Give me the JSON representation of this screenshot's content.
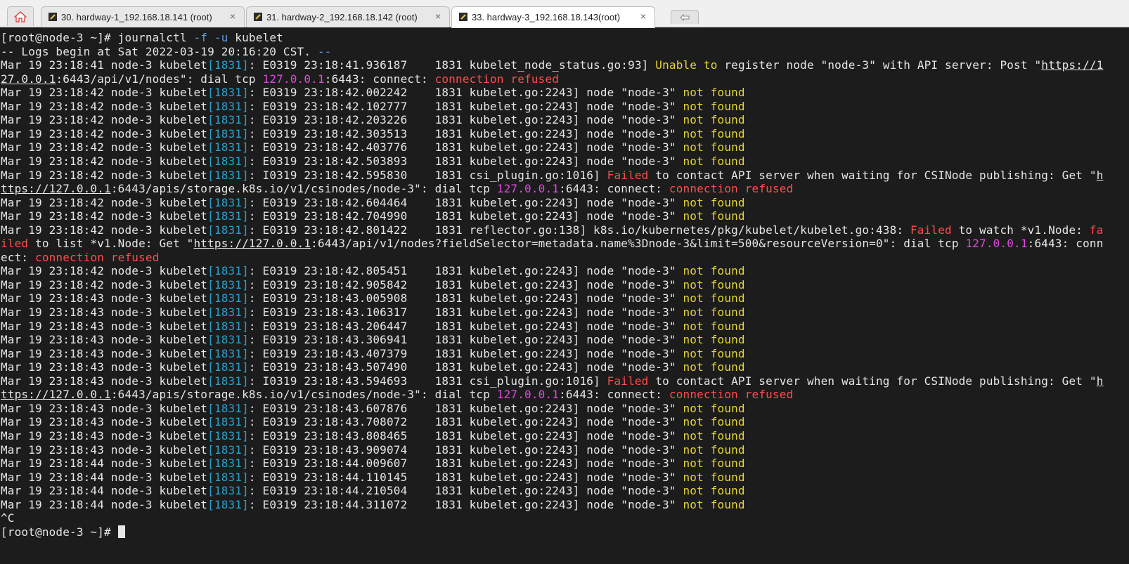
{
  "tabs": [
    {
      "label": "30. hardway-1_192.168.18.141 (root)",
      "close": "×",
      "icon": "terminal-tab-icon"
    },
    {
      "label": "31. hardway-2_192.168.18.142 (root)",
      "close": "×",
      "icon": "terminal-tab-icon"
    },
    {
      "label": "33. hardway-3_192.168.18.143(root)",
      "close": "×",
      "icon": "terminal-tab-icon"
    }
  ],
  "active_tab": 2,
  "colors": {
    "background": "#1c1c1c",
    "text": "#e6e6e6",
    "pid": "#2aa1c9",
    "warning": "#e5d635",
    "error": "#ff4d4d",
    "ip": "#e049e0"
  },
  "lines": [
    [
      {
        "t": "[root@node-3 ~]# journalctl "
      },
      {
        "t": "-f -u",
        "c": "opt"
      },
      {
        "t": " kubelet"
      }
    ],
    [
      {
        "t": "-- Logs begin at Sat 2022-03-19 20:16:20 CST. "
      },
      {
        "t": "--",
        "c": "opt"
      }
    ],
    [
      {
        "t": "Mar 19 23:18:41 node-3 kubelet"
      },
      {
        "t": "[1831]",
        "c": "pid"
      },
      {
        "t": ": E0319 23:18:41.936187    1831 kubelet_node_status.go:93] "
      },
      {
        "t": "Unable to",
        "c": "warn"
      },
      {
        "t": " register node \"node-3\" with API server: Post \""
      },
      {
        "t": "https://1",
        "c": "url"
      }
    ],
    [
      {
        "t": "27.0.0.1",
        "c": "url"
      },
      {
        "t": ":6443/api/v1/nodes\": dial tcp "
      },
      {
        "t": "127.0.0.1",
        "c": "ip"
      },
      {
        "t": ":6443: connect: "
      },
      {
        "t": "connection refused",
        "c": "err"
      }
    ],
    [
      {
        "t": "Mar 19 23:18:42 node-3 kubelet"
      },
      {
        "t": "[1831]",
        "c": "pid"
      },
      {
        "t": ": E0319 23:18:42.002242    1831 kubelet.go:2243] node \"node-3\" "
      },
      {
        "t": "not found",
        "c": "warn"
      }
    ],
    [
      {
        "t": "Mar 19 23:18:42 node-3 kubelet"
      },
      {
        "t": "[1831]",
        "c": "pid"
      },
      {
        "t": ": E0319 23:18:42.102777    1831 kubelet.go:2243] node \"node-3\" "
      },
      {
        "t": "not found",
        "c": "warn"
      }
    ],
    [
      {
        "t": "Mar 19 23:18:42 node-3 kubelet"
      },
      {
        "t": "[1831]",
        "c": "pid"
      },
      {
        "t": ": E0319 23:18:42.203226    1831 kubelet.go:2243] node \"node-3\" "
      },
      {
        "t": "not found",
        "c": "warn"
      }
    ],
    [
      {
        "t": "Mar 19 23:18:42 node-3 kubelet"
      },
      {
        "t": "[1831]",
        "c": "pid"
      },
      {
        "t": ": E0319 23:18:42.303513    1831 kubelet.go:2243] node \"node-3\" "
      },
      {
        "t": "not found",
        "c": "warn"
      }
    ],
    [
      {
        "t": "Mar 19 23:18:42 node-3 kubelet"
      },
      {
        "t": "[1831]",
        "c": "pid"
      },
      {
        "t": ": E0319 23:18:42.403776    1831 kubelet.go:2243] node \"node-3\" "
      },
      {
        "t": "not found",
        "c": "warn"
      }
    ],
    [
      {
        "t": "Mar 19 23:18:42 node-3 kubelet"
      },
      {
        "t": "[1831]",
        "c": "pid"
      },
      {
        "t": ": E0319 23:18:42.503893    1831 kubelet.go:2243] node \"node-3\" "
      },
      {
        "t": "not found",
        "c": "warn"
      }
    ],
    [
      {
        "t": "Mar 19 23:18:42 node-3 kubelet"
      },
      {
        "t": "[1831]",
        "c": "pid"
      },
      {
        "t": ": I0319 23:18:42.595830    1831 csi_plugin.go:1016] "
      },
      {
        "t": "Failed",
        "c": "err"
      },
      {
        "t": " to contact API server when waiting for CSINode publishing: Get \""
      },
      {
        "t": "h",
        "c": "url"
      }
    ],
    [
      {
        "t": "ttps://127.0.0.1",
        "c": "url"
      },
      {
        "t": ":6443/apis/storage.k8s.io/v1/csinodes/node-3\": dial tcp "
      },
      {
        "t": "127.0.0.1",
        "c": "ip"
      },
      {
        "t": ":6443: connect: "
      },
      {
        "t": "connection refused",
        "c": "err"
      }
    ],
    [
      {
        "t": "Mar 19 23:18:42 node-3 kubelet"
      },
      {
        "t": "[1831]",
        "c": "pid"
      },
      {
        "t": ": E0319 23:18:42.604464    1831 kubelet.go:2243] node \"node-3\" "
      },
      {
        "t": "not found",
        "c": "warn"
      }
    ],
    [
      {
        "t": "Mar 19 23:18:42 node-3 kubelet"
      },
      {
        "t": "[1831]",
        "c": "pid"
      },
      {
        "t": ": E0319 23:18:42.704990    1831 kubelet.go:2243] node \"node-3\" "
      },
      {
        "t": "not found",
        "c": "warn"
      }
    ],
    [
      {
        "t": "Mar 19 23:18:42 node-3 kubelet"
      },
      {
        "t": "[1831]",
        "c": "pid"
      },
      {
        "t": ": E0319 23:18:42.801422    1831 reflector.go:138] k8s.io/kubernetes/pkg/kubelet/kubelet.go:438: "
      },
      {
        "t": "Failed",
        "c": "err"
      },
      {
        "t": " to watch *v1.Node: "
      },
      {
        "t": "fa",
        "c": "err"
      }
    ],
    [
      {
        "t": "iled",
        "c": "err"
      },
      {
        "t": " to list *v1.Node: Get \""
      },
      {
        "t": "https://127.0.0.1",
        "c": "url"
      },
      {
        "t": ":6443/api/v1/nodes?fieldSelector=metadata.name%3Dnode-3&limit=500&resourceVersion=0\": dial tcp "
      },
      {
        "t": "127.0.0.1",
        "c": "ip"
      },
      {
        "t": ":6443: conn"
      }
    ],
    [
      {
        "t": "ect: "
      },
      {
        "t": "connection refused",
        "c": "err"
      }
    ],
    [
      {
        "t": "Mar 19 23:18:42 node-3 kubelet"
      },
      {
        "t": "[1831]",
        "c": "pid"
      },
      {
        "t": ": E0319 23:18:42.805451    1831 kubelet.go:2243] node \"node-3\" "
      },
      {
        "t": "not found",
        "c": "warn"
      }
    ],
    [
      {
        "t": "Mar 19 23:18:42 node-3 kubelet"
      },
      {
        "t": "[1831]",
        "c": "pid"
      },
      {
        "t": ": E0319 23:18:42.905842    1831 kubelet.go:2243] node \"node-3\" "
      },
      {
        "t": "not found",
        "c": "warn"
      }
    ],
    [
      {
        "t": "Mar 19 23:18:43 node-3 kubelet"
      },
      {
        "t": "[1831]",
        "c": "pid"
      },
      {
        "t": ": E0319 23:18:43.005908    1831 kubelet.go:2243] node \"node-3\" "
      },
      {
        "t": "not found",
        "c": "warn"
      }
    ],
    [
      {
        "t": "Mar 19 23:18:43 node-3 kubelet"
      },
      {
        "t": "[1831]",
        "c": "pid"
      },
      {
        "t": ": E0319 23:18:43.106317    1831 kubelet.go:2243] node \"node-3\" "
      },
      {
        "t": "not found",
        "c": "warn"
      }
    ],
    [
      {
        "t": "Mar 19 23:18:43 node-3 kubelet"
      },
      {
        "t": "[1831]",
        "c": "pid"
      },
      {
        "t": ": E0319 23:18:43.206447    1831 kubelet.go:2243] node \"node-3\" "
      },
      {
        "t": "not found",
        "c": "warn"
      }
    ],
    [
      {
        "t": "Mar 19 23:18:43 node-3 kubelet"
      },
      {
        "t": "[1831]",
        "c": "pid"
      },
      {
        "t": ": E0319 23:18:43.306941    1831 kubelet.go:2243] node \"node-3\" "
      },
      {
        "t": "not found",
        "c": "warn"
      }
    ],
    [
      {
        "t": "Mar 19 23:18:43 node-3 kubelet"
      },
      {
        "t": "[1831]",
        "c": "pid"
      },
      {
        "t": ": E0319 23:18:43.407379    1831 kubelet.go:2243] node \"node-3\" "
      },
      {
        "t": "not found",
        "c": "warn"
      }
    ],
    [
      {
        "t": "Mar 19 23:18:43 node-3 kubelet"
      },
      {
        "t": "[1831]",
        "c": "pid"
      },
      {
        "t": ": E0319 23:18:43.507490    1831 kubelet.go:2243] node \"node-3\" "
      },
      {
        "t": "not found",
        "c": "warn"
      }
    ],
    [
      {
        "t": "Mar 19 23:18:43 node-3 kubelet"
      },
      {
        "t": "[1831]",
        "c": "pid"
      },
      {
        "t": ": I0319 23:18:43.594693    1831 csi_plugin.go:1016] "
      },
      {
        "t": "Failed",
        "c": "err"
      },
      {
        "t": " to contact API server when waiting for CSINode publishing: Get \""
      },
      {
        "t": "h",
        "c": "url"
      }
    ],
    [
      {
        "t": "ttps://127.0.0.1",
        "c": "url"
      },
      {
        "t": ":6443/apis/storage.k8s.io/v1/csinodes/node-3\": dial tcp "
      },
      {
        "t": "127.0.0.1",
        "c": "ip"
      },
      {
        "t": ":6443: connect: "
      },
      {
        "t": "connection refused",
        "c": "err"
      }
    ],
    [
      {
        "t": "Mar 19 23:18:43 node-3 kubelet"
      },
      {
        "t": "[1831]",
        "c": "pid"
      },
      {
        "t": ": E0319 23:18:43.607876    1831 kubelet.go:2243] node \"node-3\" "
      },
      {
        "t": "not found",
        "c": "warn"
      }
    ],
    [
      {
        "t": "Mar 19 23:18:43 node-3 kubelet"
      },
      {
        "t": "[1831]",
        "c": "pid"
      },
      {
        "t": ": E0319 23:18:43.708072    1831 kubelet.go:2243] node \"node-3\" "
      },
      {
        "t": "not found",
        "c": "warn"
      }
    ],
    [
      {
        "t": "Mar 19 23:18:43 node-3 kubelet"
      },
      {
        "t": "[1831]",
        "c": "pid"
      },
      {
        "t": ": E0319 23:18:43.808465    1831 kubelet.go:2243] node \"node-3\" "
      },
      {
        "t": "not found",
        "c": "warn"
      }
    ],
    [
      {
        "t": "Mar 19 23:18:43 node-3 kubelet"
      },
      {
        "t": "[1831]",
        "c": "pid"
      },
      {
        "t": ": E0319 23:18:43.909074    1831 kubelet.go:2243] node \"node-3\" "
      },
      {
        "t": "not found",
        "c": "warn"
      }
    ],
    [
      {
        "t": "Mar 19 23:18:44 node-3 kubelet"
      },
      {
        "t": "[1831]",
        "c": "pid"
      },
      {
        "t": ": E0319 23:18:44.009607    1831 kubelet.go:2243] node \"node-3\" "
      },
      {
        "t": "not found",
        "c": "warn"
      }
    ],
    [
      {
        "t": "Mar 19 23:18:44 node-3 kubelet"
      },
      {
        "t": "[1831]",
        "c": "pid"
      },
      {
        "t": ": E0319 23:18:44.110145    1831 kubelet.go:2243] node \"node-3\" "
      },
      {
        "t": "not found",
        "c": "warn"
      }
    ],
    [
      {
        "t": "Mar 19 23:18:44 node-3 kubelet"
      },
      {
        "t": "[1831]",
        "c": "pid"
      },
      {
        "t": ": E0319 23:18:44.210504    1831 kubelet.go:2243] node \"node-3\" "
      },
      {
        "t": "not found",
        "c": "warn"
      }
    ],
    [
      {
        "t": "Mar 19 23:18:44 node-3 kubelet"
      },
      {
        "t": "[1831]",
        "c": "pid"
      },
      {
        "t": ": E0319 23:18:44.311072    1831 kubelet.go:2243] node \"node-3\" "
      },
      {
        "t": "not found",
        "c": "warn"
      }
    ],
    [
      {
        "t": "^C"
      }
    ],
    [
      {
        "t": "[root@node-3 ~]# "
      }
    ]
  ]
}
